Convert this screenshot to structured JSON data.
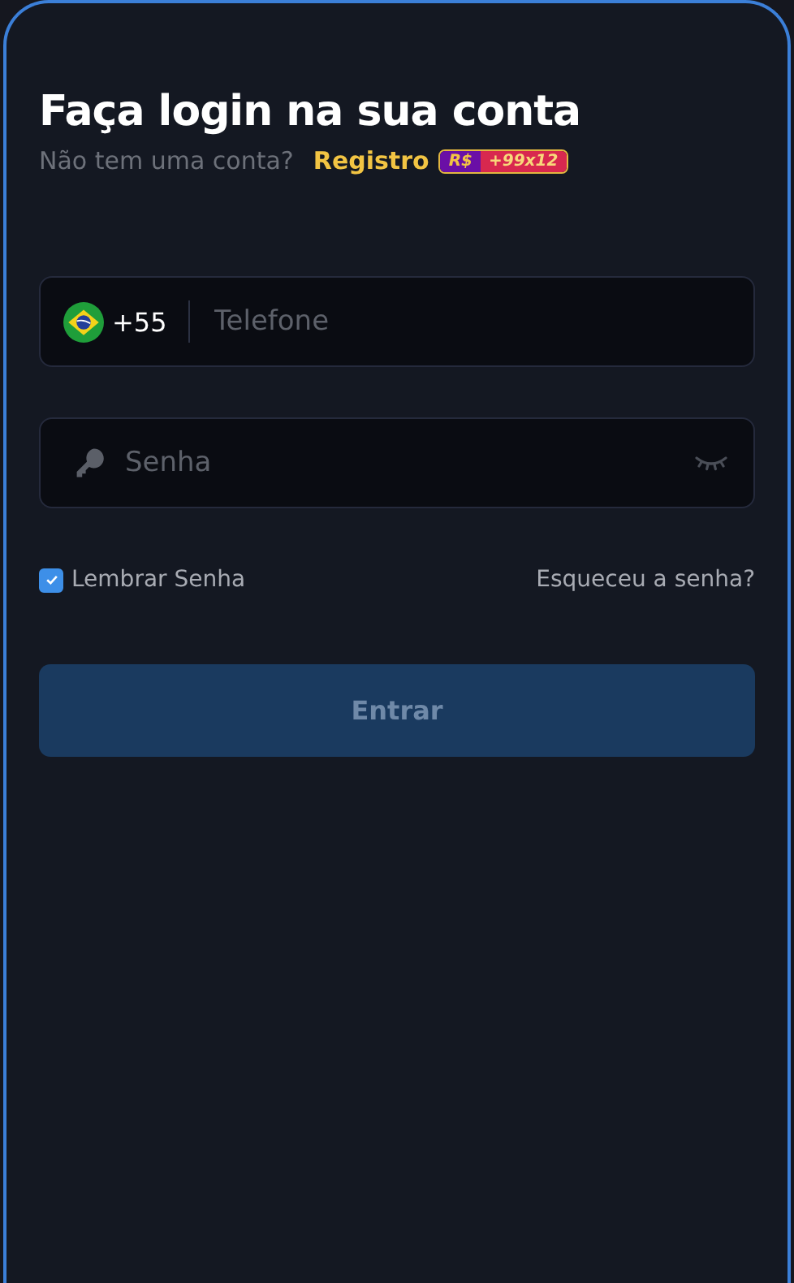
{
  "title": "Faça login na sua conta",
  "register_prompt": {
    "text": "Não tem uma conta?",
    "link": "Registro",
    "badge_currency": "R$",
    "badge_bonus": "+99x12"
  },
  "phone_field": {
    "country_code": "+55",
    "placeholder": "Telefone"
  },
  "password_field": {
    "placeholder": "Senha",
    "visible": false
  },
  "remember": {
    "label": "Lembrar Senha",
    "checked": true
  },
  "forgot_link": "Esqueceu a senha?",
  "submit": {
    "label": "Entrar",
    "disabled": true
  }
}
